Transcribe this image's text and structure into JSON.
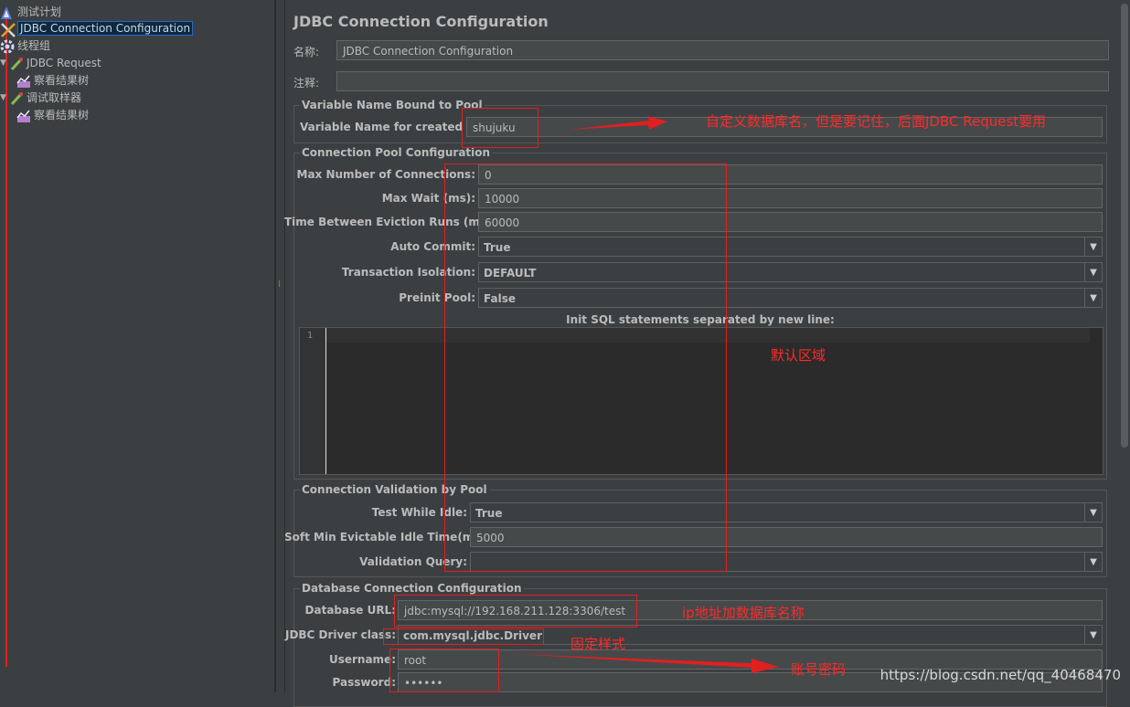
{
  "tree": {
    "items": [
      {
        "label": "测试计划"
      },
      {
        "label": "JDBC Connection Configuration"
      },
      {
        "label": "线程组"
      },
      {
        "label": "JDBC Request"
      },
      {
        "label": "察看结果树"
      },
      {
        "label": "调试取样器"
      },
      {
        "label": "察看结果树"
      }
    ]
  },
  "panel": {
    "title": "JDBC Connection Configuration",
    "name_label": "名称:",
    "name_value": "JDBC Connection Configuration",
    "comment_label": "注释:",
    "comment_value": ""
  },
  "var_section": {
    "title": "Variable Name Bound to Pool",
    "label": "Variable Name for created pool:",
    "value": "shujuku"
  },
  "pool_section": {
    "title": "Connection Pool Configuration",
    "max_conn_label": "Max Number of Connections:",
    "max_conn_value": "0",
    "max_wait_label": "Max Wait (ms):",
    "max_wait_value": "10000",
    "eviction_label": "Time Between Eviction Runs (ms):",
    "eviction_value": "60000",
    "auto_commit_label": "Auto Commit:",
    "auto_commit_value": "True",
    "isolation_label": "Transaction Isolation:",
    "isolation_value": "DEFAULT",
    "preinit_label": "Preinit Pool:",
    "preinit_value": "False",
    "init_sql_label": "Init SQL statements separated by new line:",
    "line_number": "1"
  },
  "validation_section": {
    "title": "Connection Validation by Pool",
    "test_idle_label": "Test While Idle:",
    "test_idle_value": "True",
    "soft_min_label": "Soft Min Evictable Idle Time(ms):",
    "soft_min_value": "5000",
    "query_label": "Validation Query:",
    "query_value": ""
  },
  "db_section": {
    "title": "Database Connection Configuration",
    "url_label": "Database URL:",
    "url_value": "jdbc:mysql://192.168.211.128:3306/test",
    "driver_label": "JDBC Driver class:",
    "driver_value": "com.mysql.jdbc.Driver",
    "username_label": "Username:",
    "username_value": "root",
    "password_label": "Password:",
    "password_value": "••••••"
  },
  "annotations": {
    "pool_note": "自定义数据库名，但是要记住，后面JDBC Request要用",
    "default_note": "默认区域",
    "url_note": "ip地址加数据库名称",
    "driver_note": "固定样式",
    "account_note": "账号密码"
  },
  "watermark": "https://blog.csdn.net/qq_40468470",
  "colors": {
    "background": "#3c3f41",
    "annotation_red": "#e02020",
    "selection": "#0d293e"
  }
}
